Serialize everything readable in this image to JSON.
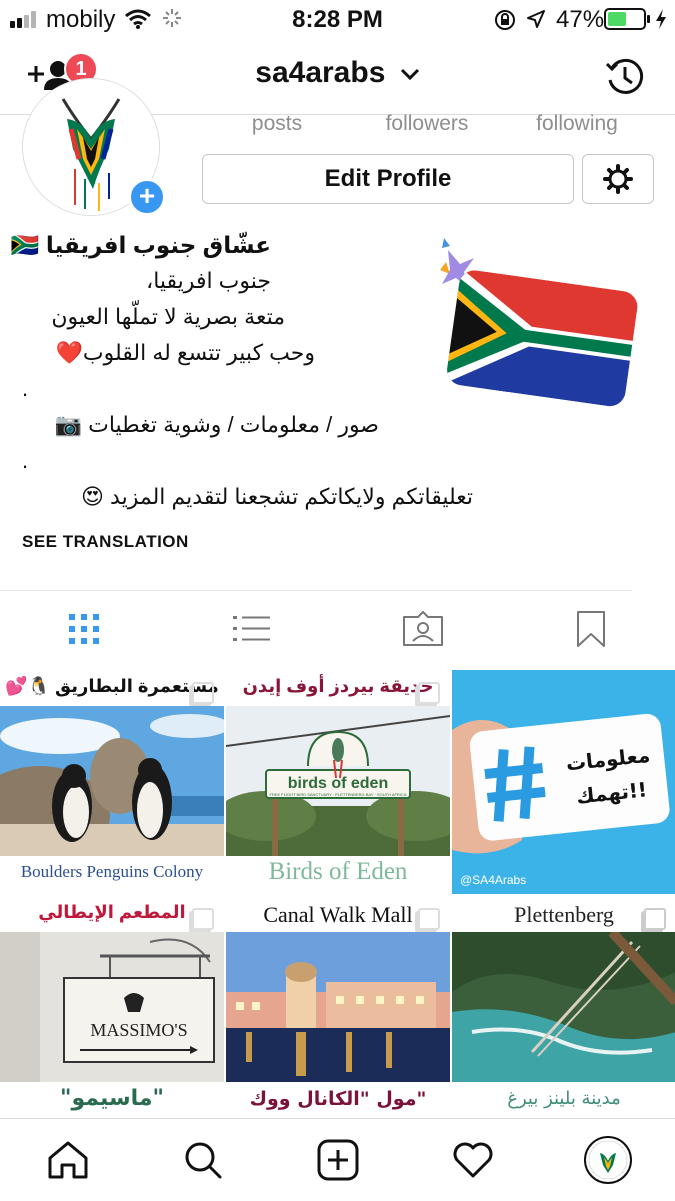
{
  "status_bar": {
    "carrier": "mobily",
    "time": "8:28 PM",
    "battery": "47%"
  },
  "header": {
    "username": "sa4arabs",
    "notification_count": "1"
  },
  "profile": {
    "stats": {
      "posts_label": "posts",
      "followers_label": "followers",
      "following_label": "following"
    },
    "edit_button": "Edit Profile",
    "bio": {
      "name": "عشّاق جنوب افريقيا 🇿🇦",
      "lines": [
        "جنوب افريقيا،",
        "متعة بصرية لا تملّها العيون",
        "وحب كبير تتسع له القلوب❤️",
        ".",
        "صور / معلومات / وشوية تغطيات 📷",
        ".",
        "تعليقاتكم ولايكاتكم تشجعنا لتقديم المزيد 😍"
      ]
    },
    "see_translation": "SEE TRANSLATION"
  },
  "posts": [
    {
      "title": "مستعمرة البطاريق 🐧💕",
      "caption": "Boulders Penguins Colony"
    },
    {
      "title": "حديقة بيردز أوف إيدن",
      "caption": "Birds of Eden",
      "sign_text": "birds of eden",
      "sign_sub": "FREE FLIGHT BIRD SANCTUARY · PLETTENBERG BAY · SOUTH AFRICA"
    },
    {
      "card_text_1": "معلومات",
      "card_text_2": "تهمك!!",
      "handle": "@SA4Arabs"
    },
    {
      "title": "المطعم الإيطالي",
      "caption": "\"ماسيمو\"",
      "sign_text": "MASSIMO'S"
    },
    {
      "title": "Canal Walk Mall",
      "caption": "مول \"الكانال ووك\""
    },
    {
      "title": "Plettenberg",
      "caption": "مدينة بلينز بيرغ"
    }
  ],
  "colors": {
    "accent_blue": "#3897f0",
    "badge_red": "#ed4956",
    "caption_blue": "#2a4f8f",
    "caption_green": "#7fb89a",
    "caption_maroon": "#7b1239",
    "caption_teal": "#3f8f77"
  },
  "icons": [
    "add-user-icon",
    "chevron-down-icon",
    "history-icon",
    "gear-icon",
    "grid-icon",
    "list-icon",
    "tagged-icon",
    "bookmark-icon",
    "home-icon",
    "search-icon",
    "add-post-icon",
    "heart-icon"
  ]
}
